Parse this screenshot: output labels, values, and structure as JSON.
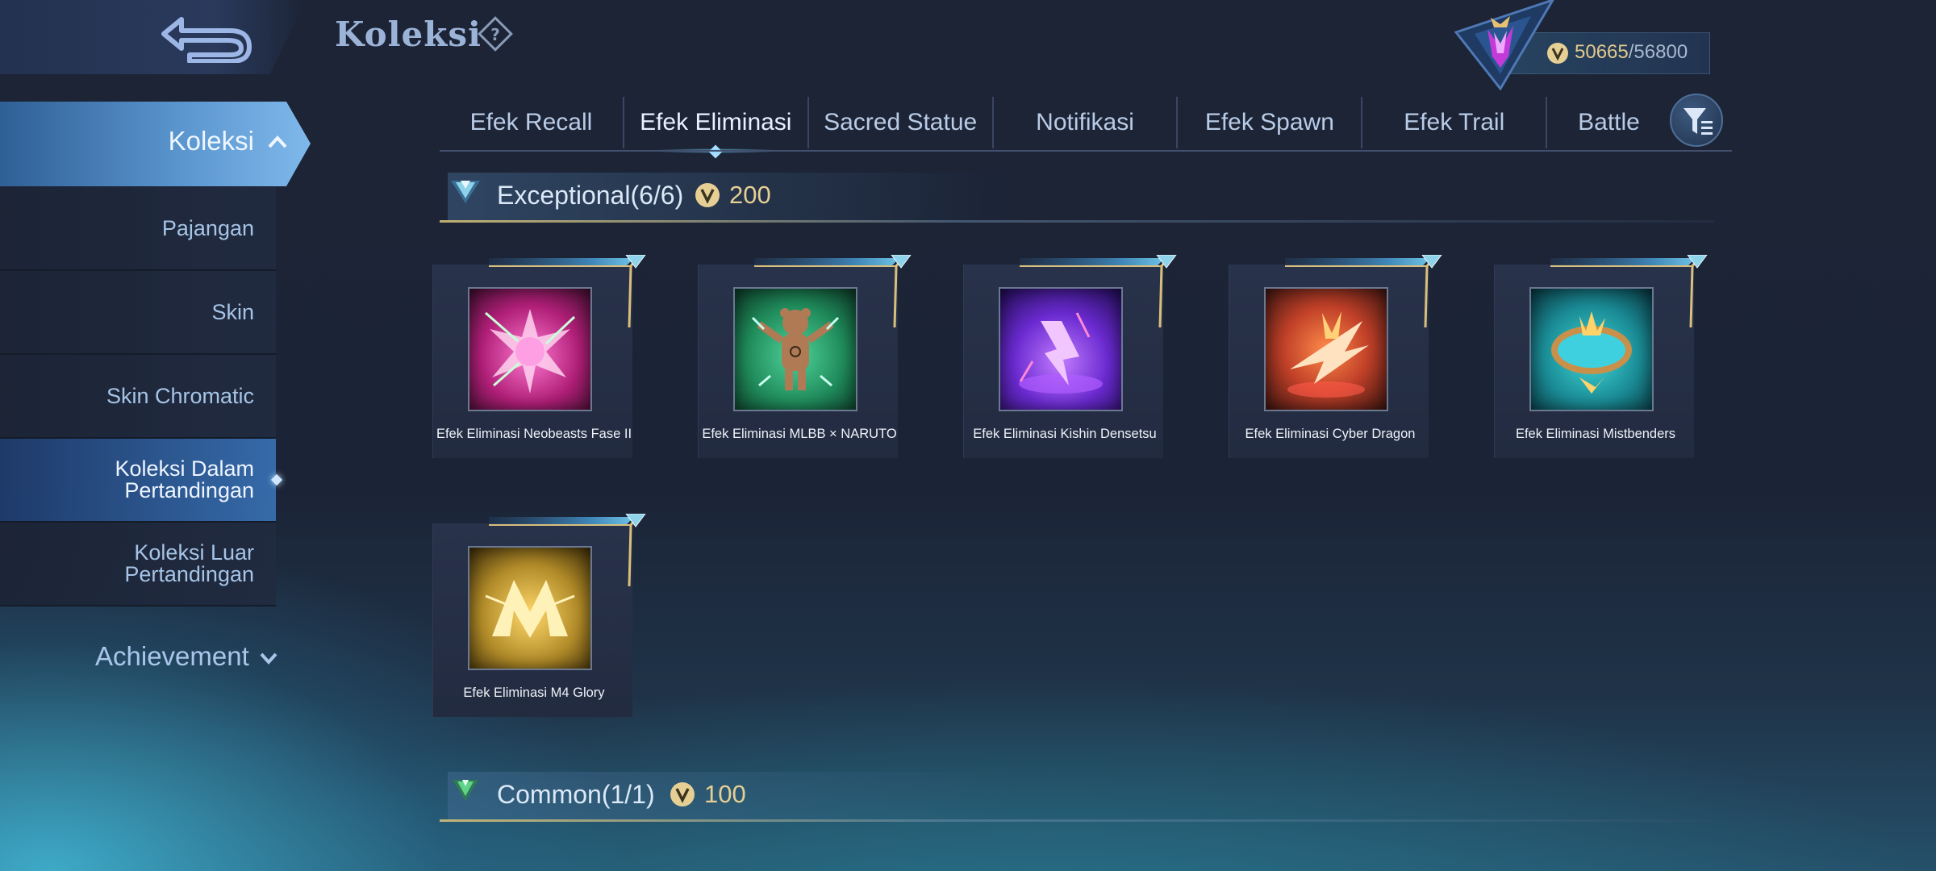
{
  "header": {
    "title": "Koleksi",
    "currency_current": "50665",
    "currency_separator": "/",
    "currency_max": "56800"
  },
  "sidebar": {
    "section_title": "Koleksi",
    "items": [
      {
        "label": "Pajangan"
      },
      {
        "label": "Skin"
      },
      {
        "label": "Skin Chromatic"
      },
      {
        "label": "Koleksi Dalam Pertandingan"
      },
      {
        "label": "Koleksi Luar Pertandingan"
      }
    ],
    "active_index": 3,
    "achievement_label": "Achievement"
  },
  "tabs": [
    {
      "label": "Efek Recall"
    },
    {
      "label": "Efek Eliminasi"
    },
    {
      "label": "Sacred Statue"
    },
    {
      "label": "Notifikasi"
    },
    {
      "label": "Efek Spawn"
    },
    {
      "label": "Efek Trail"
    },
    {
      "label": "Battle"
    }
  ],
  "active_tab": 1,
  "sections": [
    {
      "name": "Exceptional",
      "count": "(6/6)",
      "price": "200",
      "accent": "#8fd3ea",
      "items": [
        {
          "caption": "Efek Eliminasi Neobeasts Fase II",
          "icon": "neobeasts-burst",
          "bg": "#b01f78"
        },
        {
          "caption": "Efek Eliminasi MLBB × NARUTO",
          "icon": "naruto-bear",
          "bg": "#1f8a5a"
        },
        {
          "caption": "Efek Eliminasi Kishin Densetsu",
          "icon": "kishin-lightning",
          "bg": "#6a2ad0"
        },
        {
          "caption": "Efek Eliminasi Cyber Dragon",
          "icon": "cyber-dragon",
          "bg": "#c04028"
        },
        {
          "caption": "Efek Eliminasi Mistbenders",
          "icon": "mistbenders-ko",
          "bg": "#1a8a94"
        },
        {
          "caption": "Efek Eliminasi M4 Glory",
          "icon": "m4-glory",
          "bg": "#b08a28"
        }
      ]
    },
    {
      "name": "Common",
      "count": "(1/1)",
      "price": "100",
      "accent": "#5fd38a"
    }
  ],
  "colors": {
    "gold": "#e6cf94",
    "accent_blue": "#5c97d0"
  }
}
